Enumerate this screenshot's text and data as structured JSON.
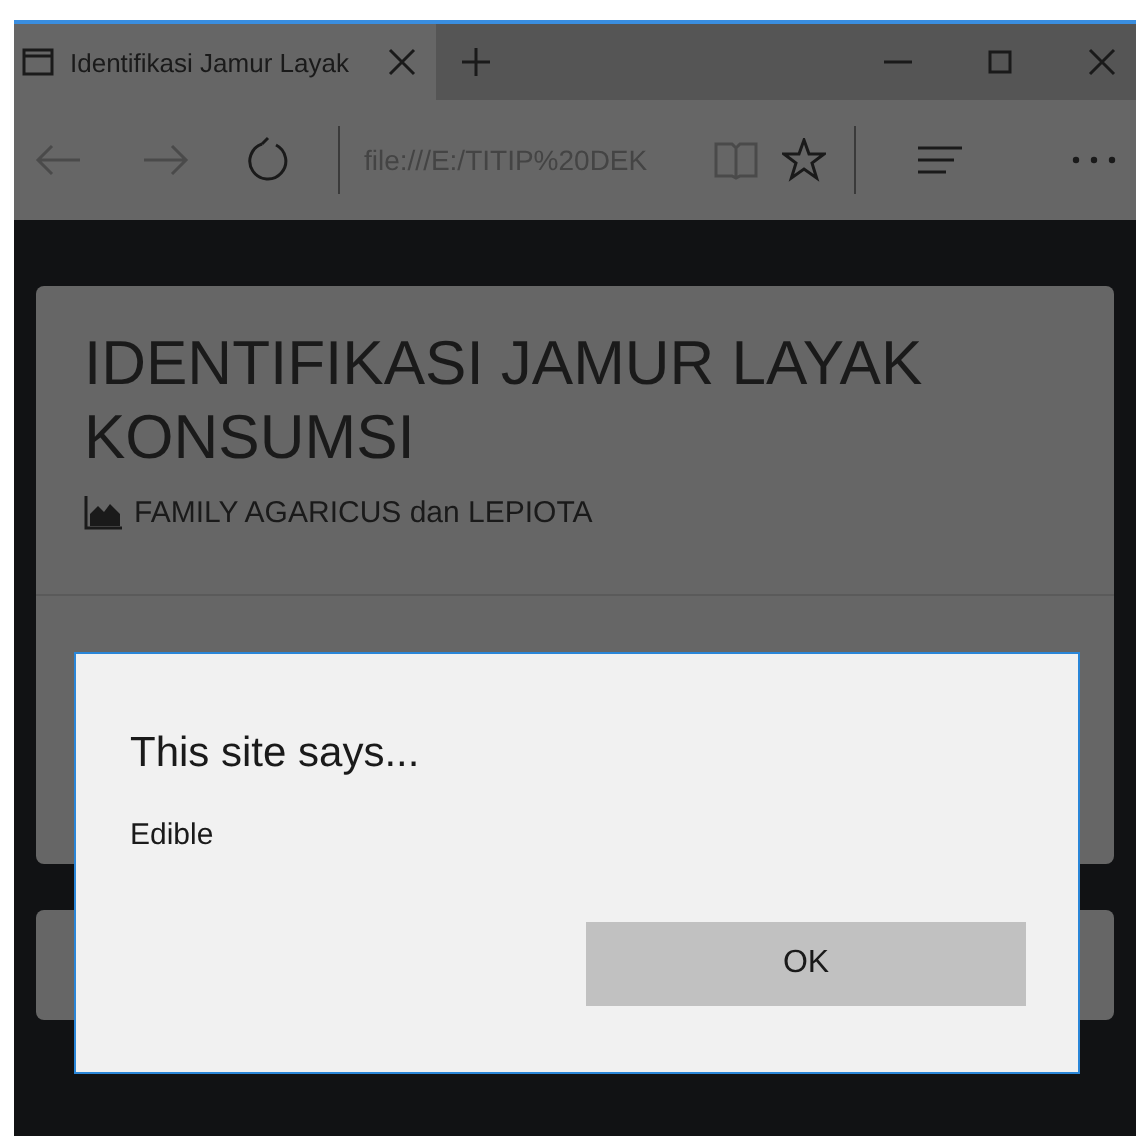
{
  "browser": {
    "tab": {
      "title": "Identifikasi Jamur Layak",
      "selected": true
    },
    "address": "file:///E:/TITIP%20DEK"
  },
  "page": {
    "heading": "IDENTIFIKASI JAMUR LAYAK KONSUMSI",
    "subheading": "FAMILY AGARICUS dan LEPIOTA"
  },
  "dialog": {
    "title": "This site says...",
    "message": "Edible",
    "buttons": [
      "OK"
    ]
  }
}
